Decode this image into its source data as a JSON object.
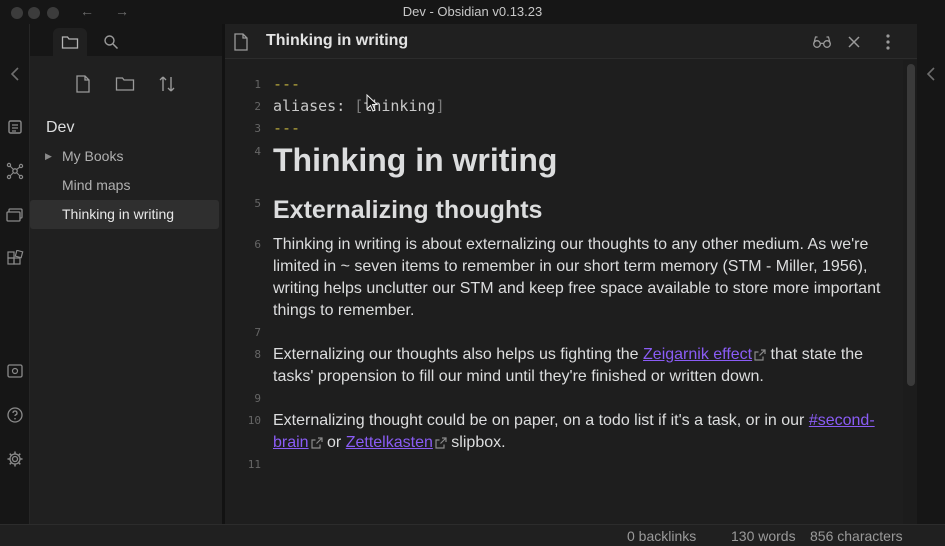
{
  "window": {
    "title": "Dev - Obsidian v0.13.23"
  },
  "sidebar": {
    "vault_name": "Dev",
    "tree": [
      {
        "label": "My Books"
      },
      {
        "label": "Mind maps"
      },
      {
        "label": "Thinking in writing"
      }
    ]
  },
  "editor": {
    "title": "Thinking in writing",
    "line_numbers": [
      "1",
      "2",
      "3",
      "4",
      "5",
      "6",
      "7",
      "8",
      "9",
      "10",
      "11"
    ],
    "frontmatter": {
      "open": "---",
      "key": "aliases:",
      "bracket_open": "[",
      "value": "thinking",
      "bracket_close": "]",
      "close": "---"
    },
    "h1": "Thinking in writing",
    "h2": "Externalizing thoughts",
    "para1": "Thinking in writing is about externalizing our thoughts to any other medium. As we're limited in ~ seven items to remember in our short term memory (STM - Miller, 1956), writing helps unclutter our STM and keep free space available to store more important things to remember.",
    "para2": {
      "before": "Externalizing our thoughts also helps us fighting the ",
      "link": "Zeigarnik effect",
      "after": " that state the tasks' propension to fill our mind until they're finished or written down."
    },
    "para3": {
      "before": "Externalizing thought could be on paper, on a todo list if it's a task, or in our ",
      "link1": "#second-brain",
      "middle": " or ",
      "link2": "Zettelkasten",
      "after": " slipbox."
    }
  },
  "status": {
    "backlinks": "0 backlinks",
    "words": "130 words",
    "characters": "856 characters"
  },
  "colors": {
    "accent": "#8a5cf5",
    "frontmatter_dash": "#b9a93d",
    "background": "#1e1e1e"
  }
}
